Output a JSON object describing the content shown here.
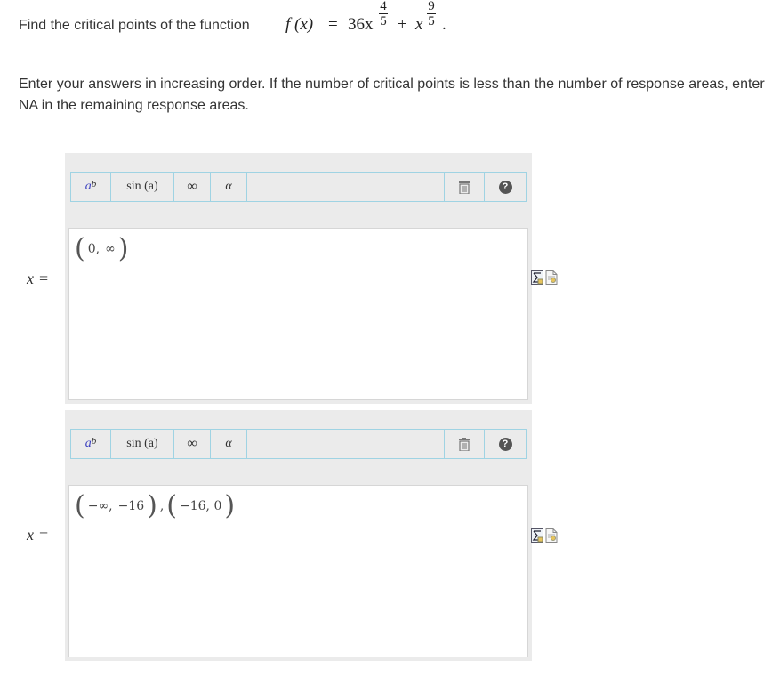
{
  "question": {
    "lead_text": "Find the critical points of the function",
    "function_lhs": "f (x)",
    "equals": "=",
    "term1_coef": "36x",
    "term1_exp_num": "4",
    "term1_exp_den": "5",
    "plus": "+",
    "term2_base": "x",
    "term2_exp_num": "9",
    "term2_exp_den": "5",
    "period": ".",
    "instructions": "Enter your answers in increasing order. If the number of critical points is less than the number of response areas, enter NA in the remaining response areas."
  },
  "toolbar": {
    "power_label": "a",
    "power_sup": "b",
    "sin_label": "sin (a)",
    "infinity_label": "∞",
    "alpha_label": "α",
    "help_label": "?"
  },
  "answers": [
    {
      "label_var": "x",
      "label_eq": "=",
      "tokens": [
        {
          "kind": "paren",
          "text": "("
        },
        {
          "kind": "text",
          "text": "0,"
        },
        {
          "kind": "text",
          "text": "∞"
        },
        {
          "kind": "paren",
          "text": ")"
        }
      ]
    },
    {
      "label_var": "x",
      "label_eq": "=",
      "tokens": [
        {
          "kind": "paren",
          "text": "("
        },
        {
          "kind": "text",
          "text": "−∞,"
        },
        {
          "kind": "text",
          "text": "−16"
        },
        {
          "kind": "paren",
          "text": ")"
        },
        {
          "kind": "text",
          "text": ","
        },
        {
          "kind": "paren",
          "text": "("
        },
        {
          "kind": "text",
          "text": "−16, 0"
        },
        {
          "kind": "paren",
          "text": ")"
        }
      ]
    }
  ],
  "colors": {
    "toolbar_border": "#9fd3e3",
    "editor_bg": "#ebebeb",
    "power_a": "#3a3fbf",
    "help_bg": "#555555"
  },
  "icons": [
    "trash-icon",
    "help-icon",
    "sigma-icon",
    "doc-icon"
  ]
}
